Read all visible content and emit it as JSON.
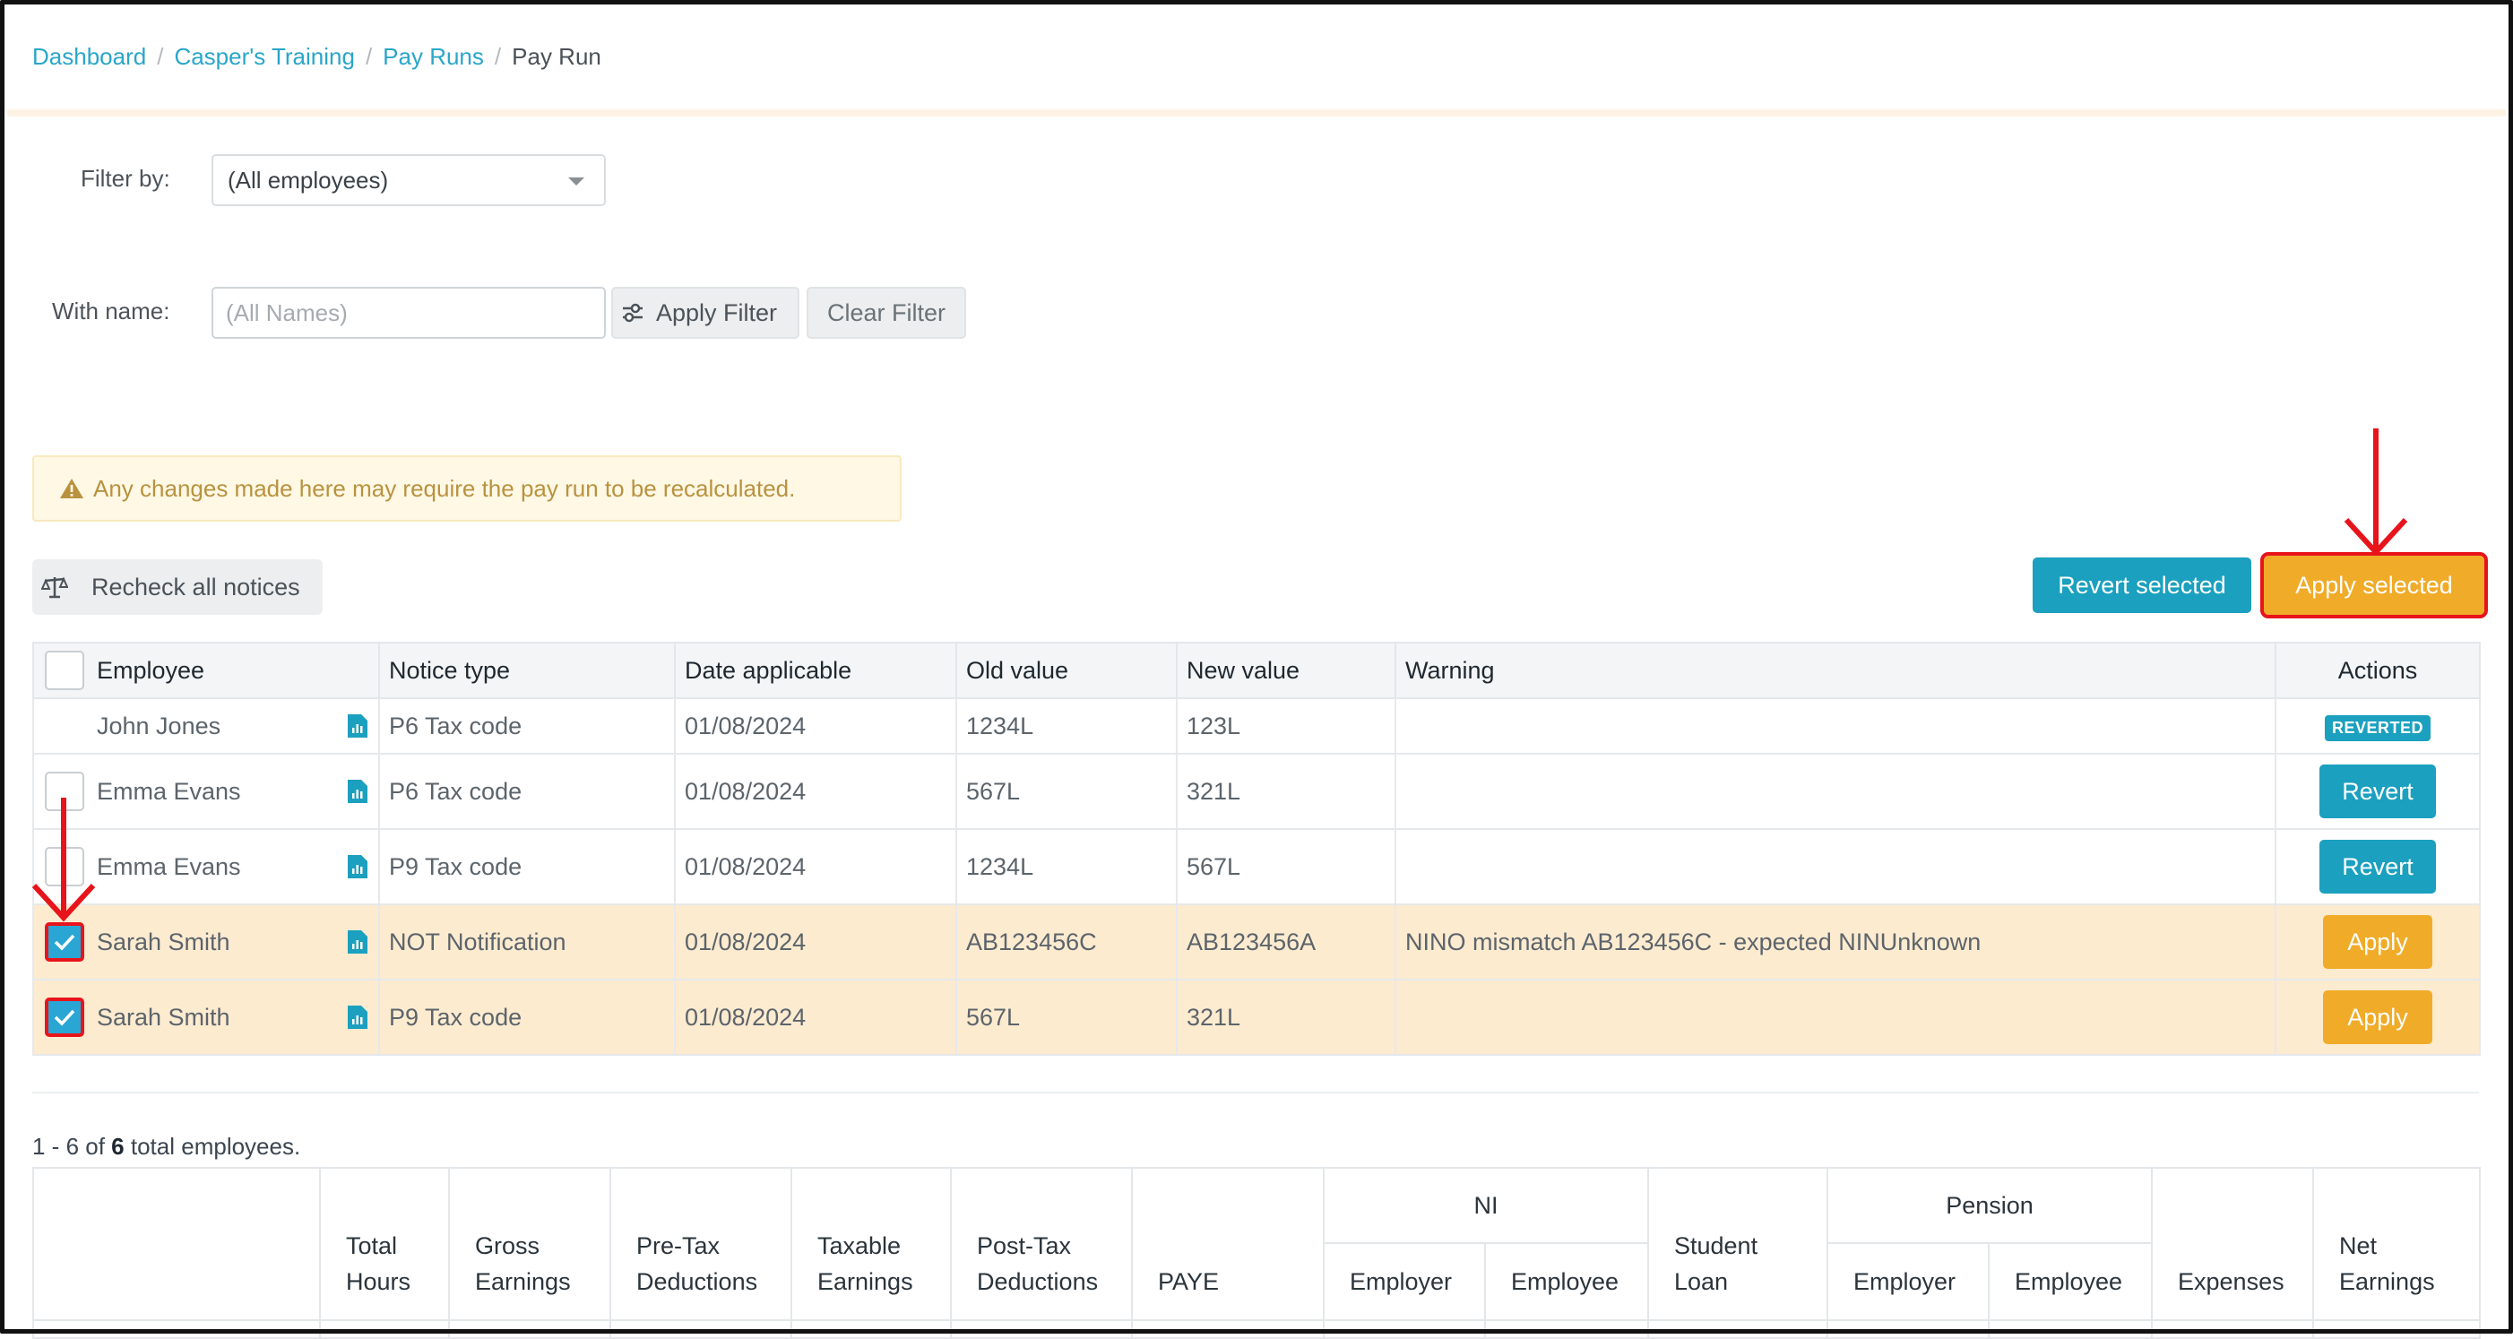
{
  "breadcrumb": {
    "items": [
      "Dashboard",
      "Casper's Training",
      "Pay Runs"
    ],
    "current": "Pay Run",
    "separator": "/"
  },
  "filters": {
    "filter_by_label": "Filter by:",
    "filter_by_value": "(All employees)",
    "with_name_label": "With name:",
    "name_placeholder": "(All Names)",
    "apply_filter": "Apply Filter",
    "clear_filter": "Clear Filter"
  },
  "alert": {
    "text": "Any changes made here may require the pay run to be recalculated."
  },
  "toolbar": {
    "recheck": "Recheck all notices",
    "revert_selected": "Revert selected",
    "apply_selected": "Apply selected"
  },
  "notices": {
    "headers": [
      "Employee",
      "Notice type",
      "Date applicable",
      "Old value",
      "New value",
      "Warning",
      "Actions"
    ],
    "rows": [
      {
        "employee": "John Jones",
        "type": "P6 Tax code",
        "date": "01/08/2024",
        "old": "1234L",
        "new": "123L",
        "warning": "",
        "action": "REVERTED"
      },
      {
        "employee": "Emma Evans",
        "type": "P6 Tax code",
        "date": "01/08/2024",
        "old": "567L",
        "new": "321L",
        "warning": "",
        "action": "Revert"
      },
      {
        "employee": "Emma Evans",
        "type": "P9 Tax code",
        "date": "01/08/2024",
        "old": "1234L",
        "new": "567L",
        "warning": "",
        "action": "Revert"
      },
      {
        "employee": "Sarah Smith",
        "type": "NOT Notification",
        "date": "01/08/2024",
        "old": "AB123456C",
        "new": "AB123456A",
        "warning": "NINO mismatch AB123456C - expected NINUnknown",
        "action": "Apply"
      },
      {
        "employee": "Sarah Smith",
        "type": "P9 Tax code",
        "date": "01/08/2024",
        "old": "567L",
        "new": "321L",
        "warning": "",
        "action": "Apply"
      }
    ]
  },
  "summary": {
    "count_prefix": "1 - 6 of",
    "count_total": "6",
    "count_suffix": "total employees.",
    "headers": {
      "total_hours_1": "Total",
      "total_hours_2": "Hours",
      "gross_1": "Gross",
      "gross_2": "Earnings",
      "pretax_1": "Pre-Tax",
      "pretax_2": "Deductions",
      "taxable_1": "Taxable",
      "taxable_2": "Earnings",
      "posttax_1": "Post-Tax",
      "posttax_2": "Deductions",
      "paye": "PAYE",
      "ni": "NI",
      "ni_employer": "Employer",
      "ni_employee": "Employee",
      "student_1": "Student",
      "student_2": "Loan",
      "pension": "Pension",
      "pension_employer": "Employer",
      "pension_employee": "Employee",
      "expenses": "Expenses",
      "net_1": "Net",
      "net_2": "Earnings"
    }
  },
  "colors": {
    "link": "#2aa6c9",
    "teal": "#1ba0bf",
    "orange": "#f0ab28",
    "highlight_row": "#fdebd0",
    "annotation_red": "#e8141b"
  }
}
